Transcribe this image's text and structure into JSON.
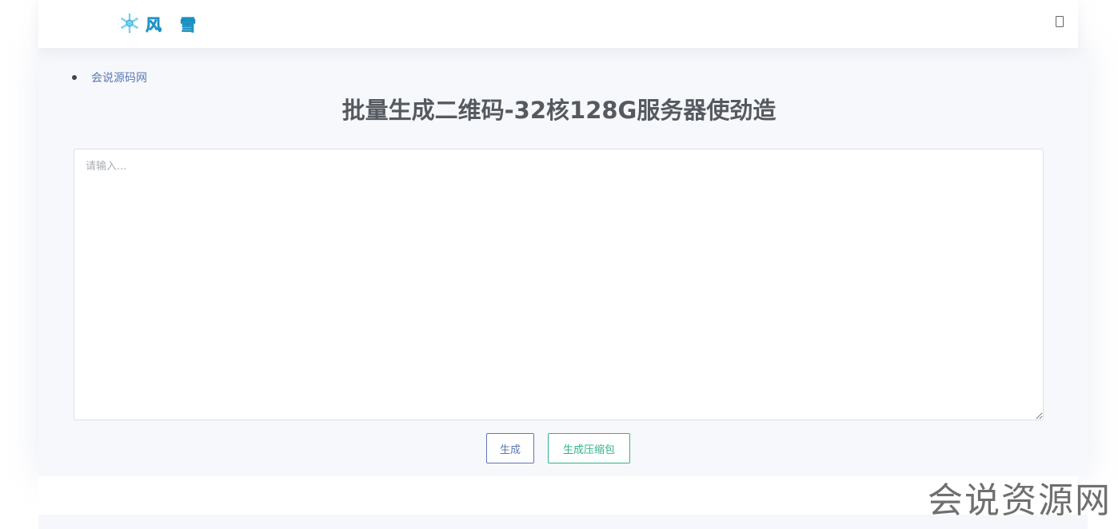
{
  "header": {
    "logo_text": "风 雪",
    "logo_icon": "snowflake-icon",
    "menu_icon": "menu-box-icon"
  },
  "breadcrumb": {
    "link": "会说源码网"
  },
  "page": {
    "title": "批量生成二维码-32核128G服务器使劲造"
  },
  "input": {
    "placeholder": "请输入...",
    "value": ""
  },
  "actions": {
    "generate_label": "生成",
    "zip_label": "生成压缩包"
  },
  "watermark": "会说资源网",
  "colors": {
    "title": "#555a60",
    "link": "#5a78b4",
    "generate_border": "#5b78b0",
    "zip_border": "#2fb48c",
    "logo": "#5ad0ef"
  }
}
